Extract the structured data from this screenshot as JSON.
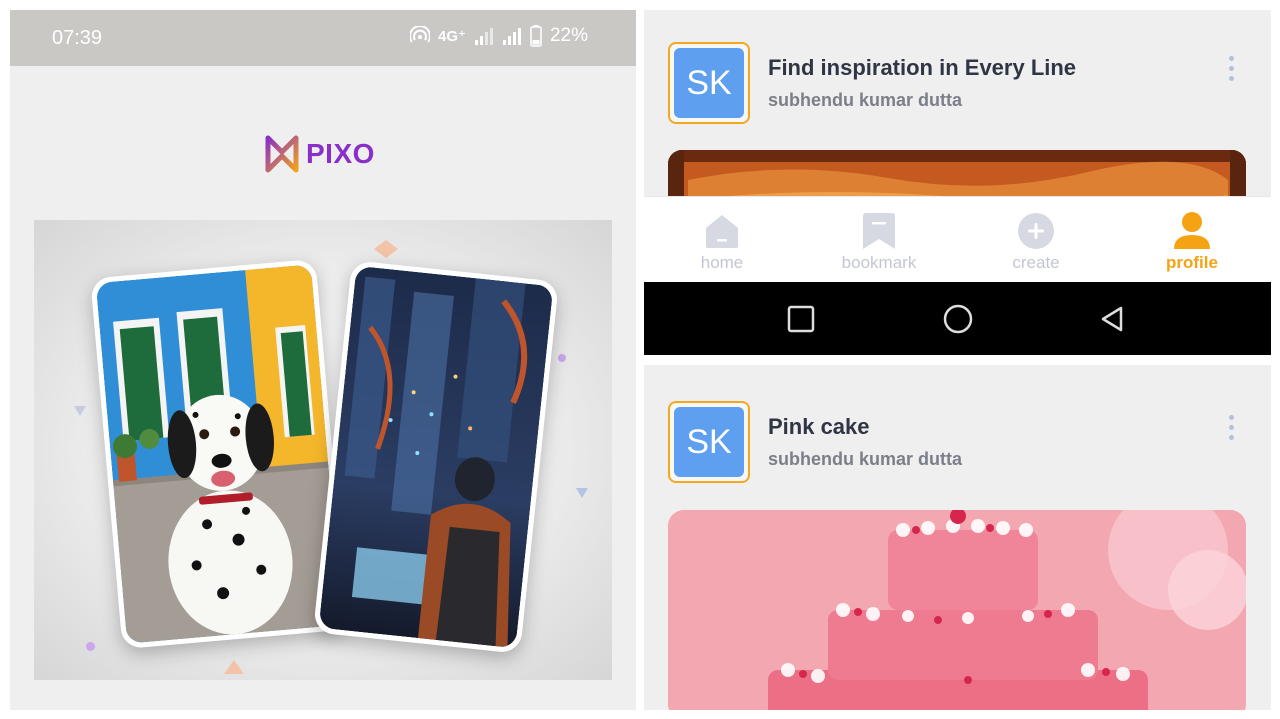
{
  "status_bar": {
    "time": "07:39",
    "network": "4G⁺",
    "battery": "22%"
  },
  "app": {
    "logo_text": "PIXO"
  },
  "posts": [
    {
      "avatar_initials": "SK",
      "title": "Find inspiration in Every Line",
      "author": "subhendu kumar dutta"
    },
    {
      "avatar_initials": "SK",
      "title": "Pink cake",
      "author": "subhendu kumar dutta"
    }
  ],
  "bottom_nav": {
    "items": [
      {
        "label": "home",
        "icon": "home-icon",
        "active": false
      },
      {
        "label": "bookmark",
        "icon": "bookmark-icon",
        "active": false
      },
      {
        "label": "create",
        "icon": "plus-circle-icon",
        "active": false
      },
      {
        "label": "profile",
        "icon": "person-icon",
        "active": true
      }
    ]
  },
  "colors": {
    "accent": "#f5a313",
    "logo": "#8a2fc7",
    "avatar": "#5f9ff0",
    "inactive_nav": "#c3c7d2",
    "title_text": "#2f3544"
  }
}
